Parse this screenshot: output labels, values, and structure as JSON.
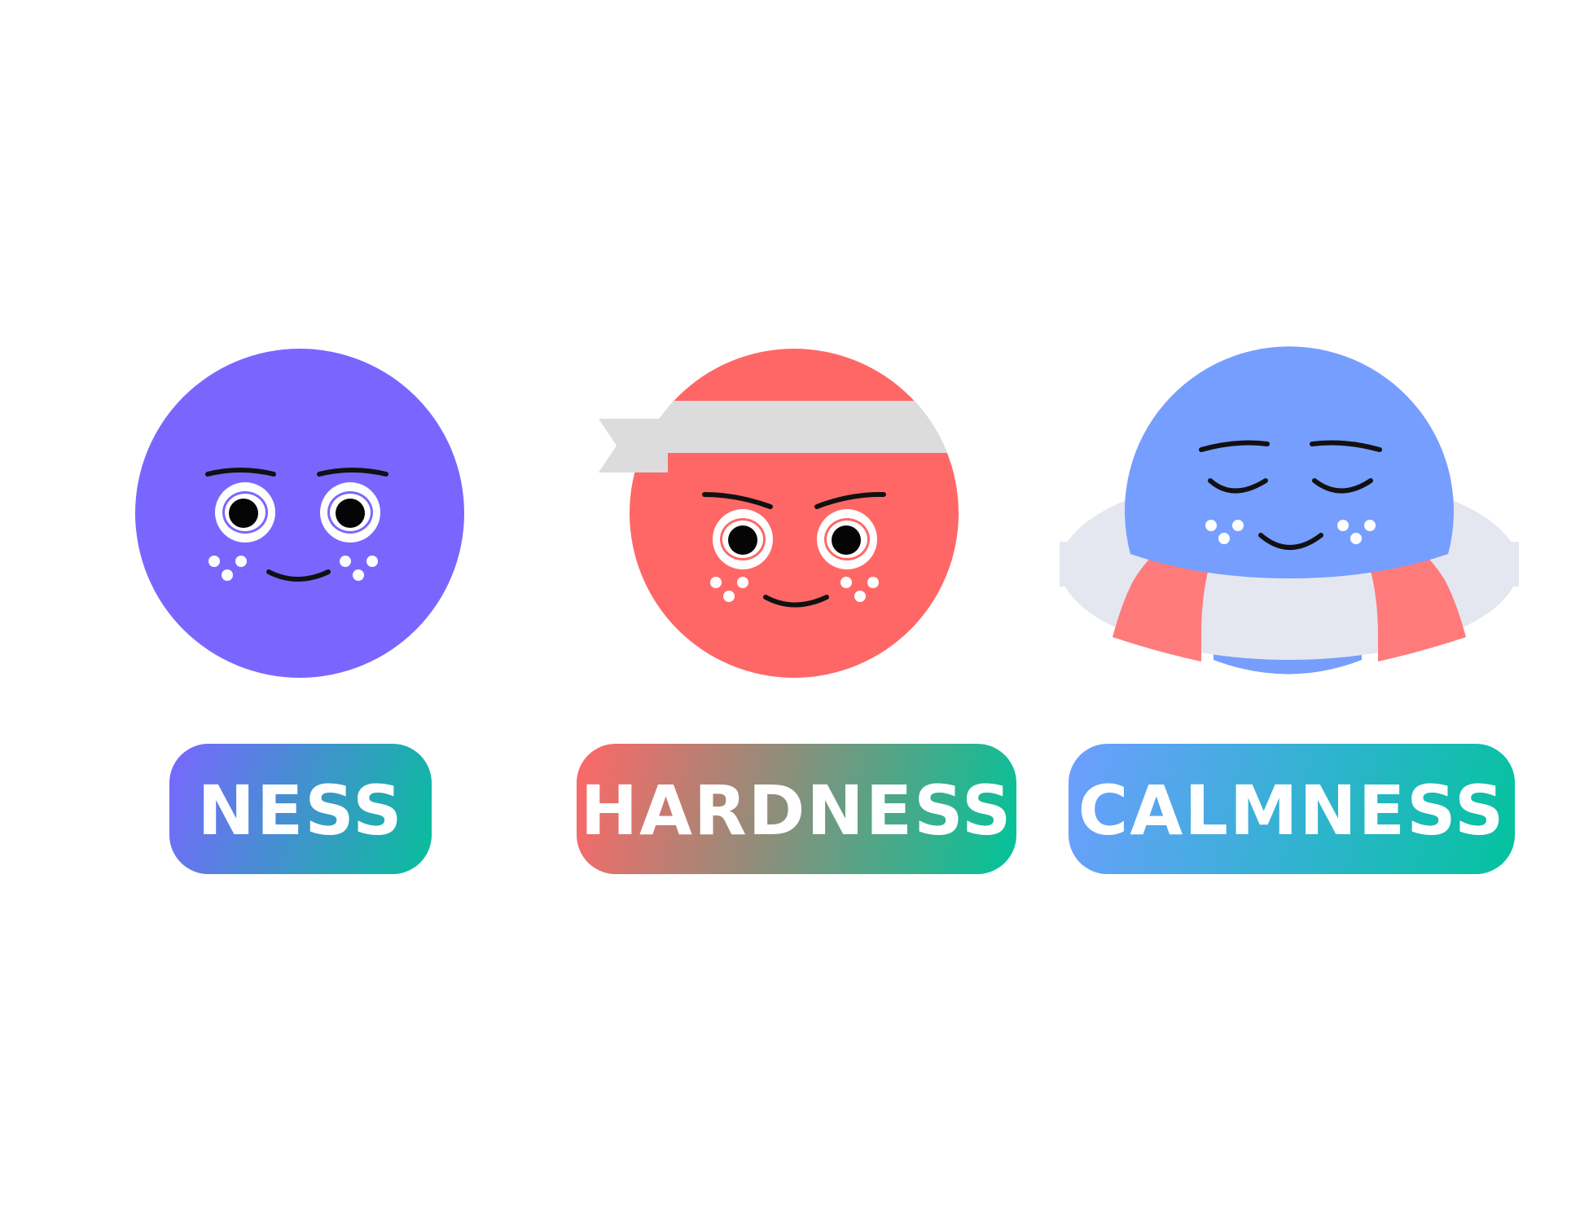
{
  "characters": [
    {
      "id": "ness",
      "label": "NESS",
      "face_color": "#7A66FF",
      "pill_gradient": [
        "#7A66FF",
        "#07BF9B"
      ]
    },
    {
      "id": "hardness",
      "label": "HARDNESS",
      "face_color": "#FF6767",
      "headband_color": "#DCDCDC",
      "pill_gradient": [
        "#FF6767",
        "#00C49A"
      ]
    },
    {
      "id": "calmness",
      "label": "CALMNESS",
      "face_color": "#769EFF",
      "float_ring_color": "#E4E7EF",
      "float_stripe_color": "#FF7B7B",
      "pill_gradient": [
        "#6E9EFF",
        "#03C39C"
      ]
    }
  ],
  "colors": {
    "background": "#FFFFFF",
    "ink": "#111111",
    "highlight": "#FFFFFF"
  }
}
